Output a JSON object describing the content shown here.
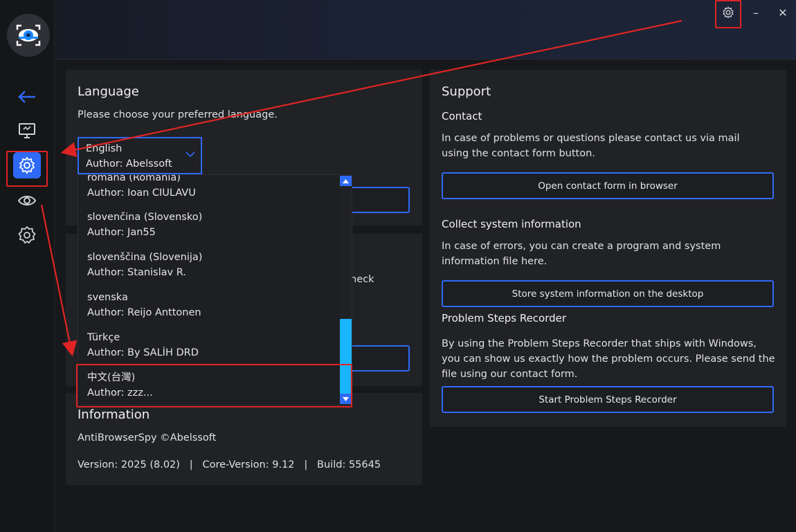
{
  "window": {
    "controls": [
      "settings-icon",
      "minimize",
      "close"
    ],
    "minimize_label": "–",
    "close_label": "✕"
  },
  "sidebar": {
    "items": [
      {
        "name": "back",
        "icon": "arrow-left-icon"
      },
      {
        "name": "monitor",
        "icon": "monitor-icon"
      },
      {
        "name": "settings",
        "icon": "gear-icon",
        "active": true
      },
      {
        "name": "eye",
        "icon": "eye-icon"
      },
      {
        "name": "badge",
        "icon": "badge-gear-icon"
      }
    ]
  },
  "language": {
    "title": "Language",
    "description": "Please choose your preferred language.",
    "selected": {
      "name": "English",
      "author": "Author: Abelssoft"
    },
    "options": [
      {
        "name": "romana (Romania)",
        "author": "Author: Ioan CIULAVU"
      },
      {
        "name": "slovenčina (Slovensko)",
        "author": "Author: Jan55"
      },
      {
        "name": "slovenščina (Slovenija)",
        "author": "Author: Stanislav R."
      },
      {
        "name": "svenska",
        "author": "Author: Reijo Anttonen"
      },
      {
        "name": "Türkçe",
        "author": "Author: By SALİH DRD"
      },
      {
        "name": "中文(台灣)",
        "author": "Author: zzz..."
      }
    ],
    "partial_text": "heck"
  },
  "information": {
    "title": "Information",
    "product": "AntiBrowserSpy ©Abelssoft",
    "version_line": "Version: 2025 (8.02)   |   Core-Version: 9.12   |   Build: 55645"
  },
  "support": {
    "title": "Support",
    "contact_title": "Contact",
    "contact_text": "In case of problems or questions please contact us via mail using the contact form button.",
    "contact_button": "Open contact form in browser",
    "collect_title": "Collect system information",
    "collect_text": "In case of errors, you can create a program and system information file here.",
    "collect_button": "Store system information on the desktop",
    "psr_title": "Problem Steps Recorder",
    "psr_text": "By using the Problem Steps Recorder that ships with Windows, you can show us exactly how the problem occurs. Please send the file using our contact form.",
    "psr_button": "Start Problem Steps Recorder"
  },
  "colors": {
    "accent": "#2f6af7",
    "highlight": "#e02424",
    "scroll_thumb": "#19b6ff"
  }
}
